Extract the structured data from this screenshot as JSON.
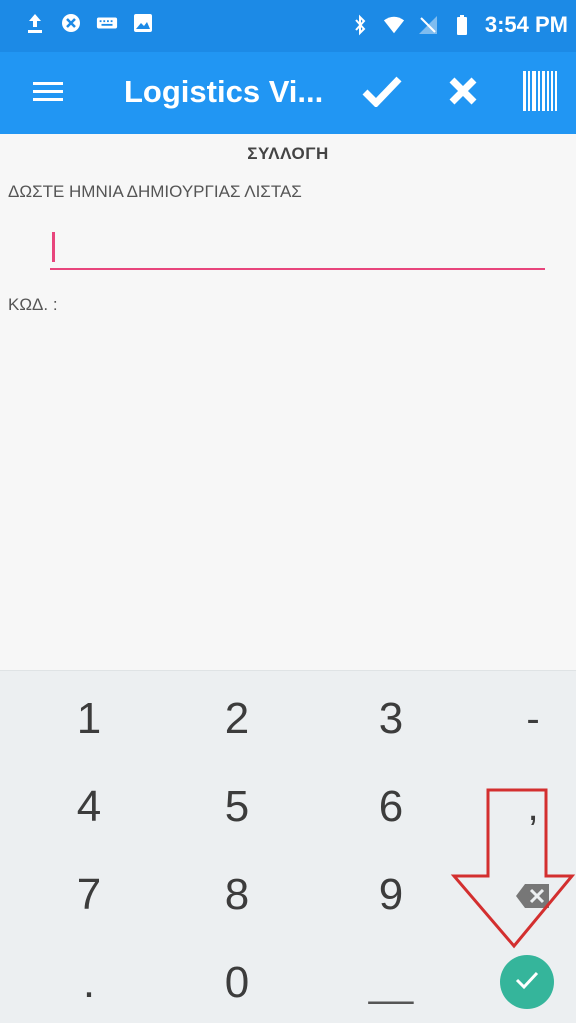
{
  "status_bar": {
    "time": "3:54 PM",
    "icons": [
      "upload-icon",
      "shield-icon",
      "keyboard-icon",
      "image-icon",
      "bluetooth-icon",
      "wifi-icon",
      "no-sim-icon",
      "battery-icon"
    ]
  },
  "app_bar": {
    "title": "Logistics Vi...",
    "actions": [
      "check-icon",
      "close-icon",
      "barcode-icon"
    ]
  },
  "form": {
    "section_title": "ΣΥΛΛΟΓΗ",
    "date_label": "ΔΩΣΤΕ ΗΜΝΙΑ ΔΗΜΙΟΥΡΓΙΑΣ ΛΙΣΤΑΣ",
    "date_value": "",
    "code_label": "ΚΩΔ. :"
  },
  "keyboard": {
    "k1": "1",
    "k2": "2",
    "k3": "3",
    "kdash": "-",
    "k4": "4",
    "k5": "5",
    "k6": "6",
    "kcomma": ",",
    "k7": "7",
    "k8": "8",
    "k9": "9",
    "kdot": ".",
    "k0": "0",
    "kspace": "__"
  },
  "colors": {
    "app_bar": "#2196f3",
    "status_bar": "#1c8ae6",
    "input_underline": "#e8457c",
    "enter_key": "#35b59b",
    "annotation_arrow": "#d32f2f"
  }
}
